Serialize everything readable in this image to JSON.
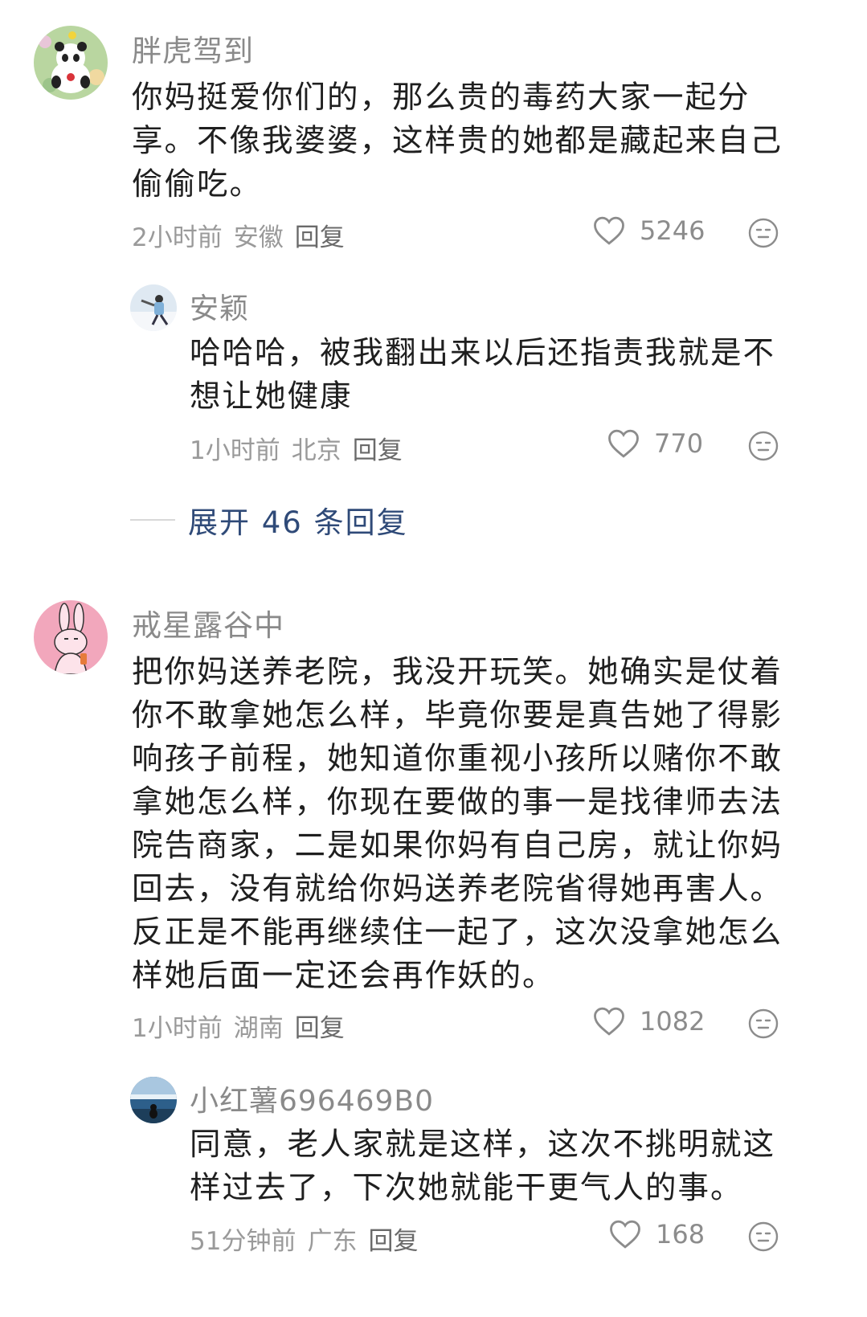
{
  "comments": [
    {
      "username": "胖虎驾到",
      "lines": [
        "你妈挺爱你们的，那么贵的毒药大家一起分",
        "享。不像我婆婆，这样贵的她都是藏起来自己",
        "偷偷吃。"
      ],
      "time": "2小时前",
      "location": "安徽",
      "reply_label": "回复",
      "likes": "5246",
      "replies": [
        {
          "username": "安颖",
          "lines": [
            "哈哈哈，被我翻出来以后还指责我就是不",
            "想让她健康"
          ],
          "time": "1小时前",
          "location": "北京",
          "reply_label": "回复",
          "likes": "770"
        }
      ],
      "expand_label": "展开 46 条回复"
    },
    {
      "username": "戒星露谷中",
      "lines": [
        "把你妈送养老院，我没开玩笑。她确实是仗着",
        "你不敢拿她怎么样，毕竟你要是真告她了得影",
        "响孩子前程，她知道你重视小孩所以赌你不敢",
        "拿她怎么样，你现在要做的事一是找律师去法",
        "院告商家，二是如果你妈有自己房，就让你妈",
        "回去，没有就给你妈送养老院省得她再害人。",
        "反正是不能再继续住一起了，这次没拿她怎么",
        "样她后面一定还会再作妖的。"
      ],
      "time": "1小时前",
      "location": "湖南",
      "reply_label": "回复",
      "likes": "1082",
      "replies": [
        {
          "username": "小红薯696469B0",
          "lines": [
            "同意，老人家就是这样，这次不挑明就这",
            "样过去了，下次她就能干更气人的事。"
          ],
          "time": "51分钟前",
          "location": "广东",
          "reply_label": "回复",
          "likes": "168"
        }
      ]
    }
  ],
  "icons": {
    "like": "heart-outline-icon",
    "dislike": "neutral-face-icon"
  },
  "colors": {
    "link": "#2f4a78",
    "secondary_text": "#9a9a9a"
  }
}
